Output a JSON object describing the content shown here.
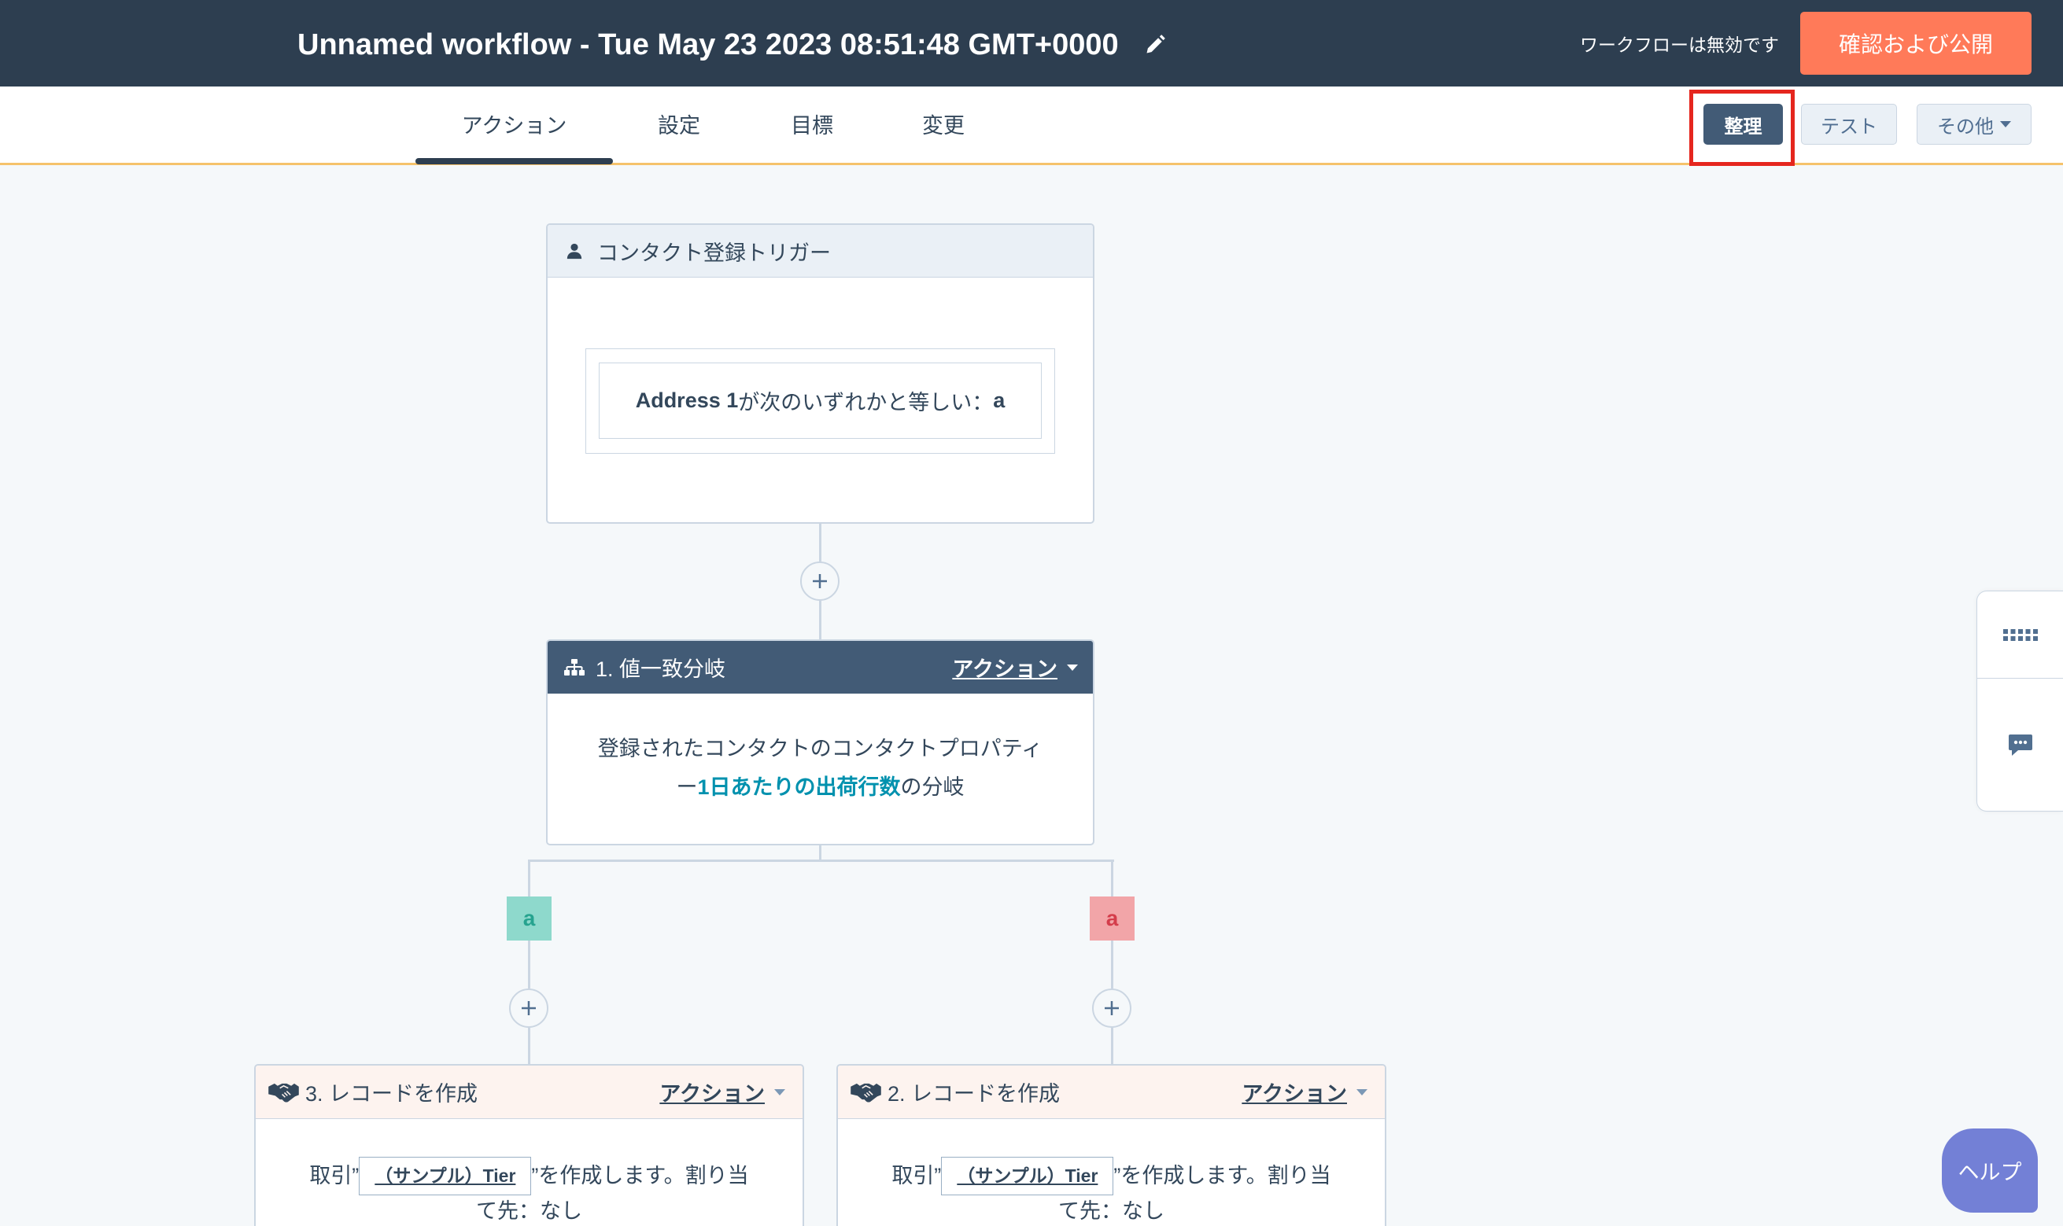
{
  "header": {
    "title": "Unnamed workflow - Tue May 23 2023 08:51:48 GMT+0000",
    "edit_icon": "pencil-icon",
    "status_text": "ワークフローは無効です",
    "publish_label": "確認および公開"
  },
  "tabs": [
    {
      "label": "アクション",
      "active": true
    },
    {
      "label": "設定",
      "active": false
    },
    {
      "label": "目標",
      "active": false
    },
    {
      "label": "変更",
      "active": false
    }
  ],
  "toolbar": {
    "organize_label": "整理",
    "test_label": "テスト",
    "more_label": "その他",
    "more_icon": "caret-down-icon"
  },
  "trigger": {
    "icon": "contact-icon",
    "title": "コンタクト登録トリガー",
    "filter": {
      "property": "Address 1",
      "operator": "が次のいずれかと等しい：",
      "value": "a"
    }
  },
  "add_step_icon": "plus-icon",
  "branch_step": {
    "icon": "branch-icon",
    "title": "1. 値一致分岐",
    "menu_label": "アクション",
    "description_line1": "登録されたコンタクトのコンタクトプロパティ",
    "description_prefix": "ー",
    "property_name": "1日あたりの出荷行数",
    "description_suffix": "の分岐"
  },
  "branches": [
    {
      "label": "a",
      "step": {
        "icon": "handshake-icon",
        "title": "3. レコードを作成",
        "menu_label": "アクション",
        "text_prefix": "取引”",
        "token": "（サンプル）Tier",
        "text_suffix": "”を作成します。割り当",
        "text_line2": "て先：なし"
      }
    },
    {
      "label": "a",
      "step": {
        "icon": "handshake-icon",
        "title": "2. レコードを作成",
        "menu_label": "アクション",
        "text_prefix": "取引”",
        "token": "（サンプル）Tier",
        "text_suffix": "”を作成します。割り当",
        "text_line2": "て先：なし"
      }
    }
  ],
  "side_panel": {
    "icons": [
      "grid-icon",
      "chat-icon"
    ]
  },
  "help": {
    "label": "ヘルプ"
  },
  "colors": {
    "header_bg": "#2d3e50",
    "publish_button": "#ff7a59",
    "branch_header_bg": "#425b76",
    "property_link": "#0091ae",
    "branch_a_bg": "#8ed9cc",
    "branch_a_text": "#26a38f",
    "branch_b_bg": "#f2a5a8",
    "branch_b_text": "#d43d4b",
    "highlight_box": "#e5261e",
    "help_button": "#7380d6",
    "canvas_bg": "#f5f8fa"
  }
}
